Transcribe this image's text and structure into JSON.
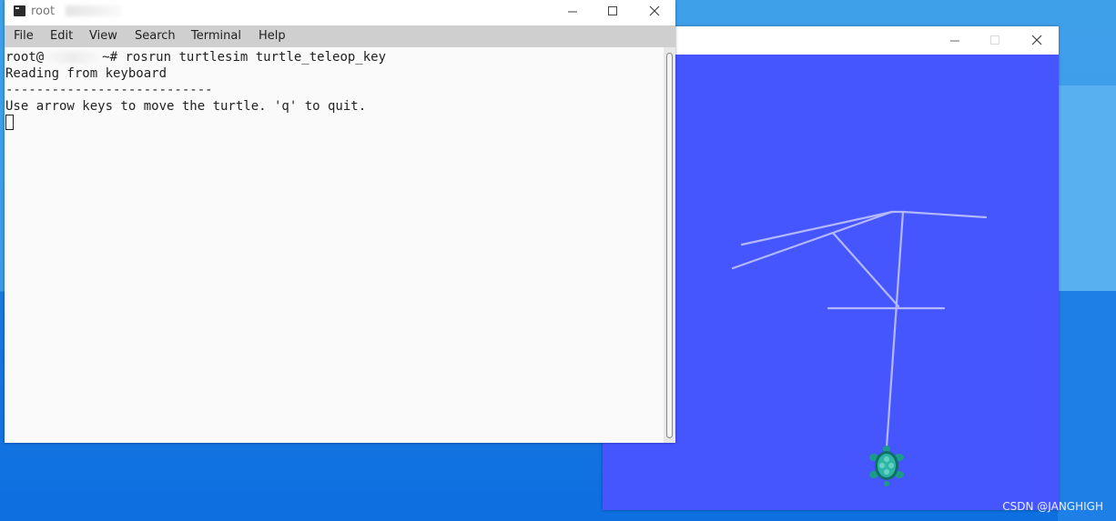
{
  "terminal": {
    "title": "root",
    "menu": [
      "File",
      "Edit",
      "View",
      "Search",
      "Terminal",
      "Help"
    ],
    "lines": {
      "prompt_prefix": "root@",
      "prompt_suffix": "~# rosrun turtlesim turtle_teleop_key",
      "line2": "Reading from keyboard",
      "line3": "---------------------------",
      "line4": "Use arrow keys to move the turtle. 'q' to quit."
    }
  },
  "turtlesim": {
    "background_color": "#4556ff",
    "pen_color": "#b3b8ff",
    "turtle_icon": "turtle-icon"
  },
  "window_controls": {
    "minimize": "minimize-icon",
    "maximize": "maximize-icon",
    "close": "close-icon"
  },
  "watermark": "CSDN @JANGHIGH"
}
